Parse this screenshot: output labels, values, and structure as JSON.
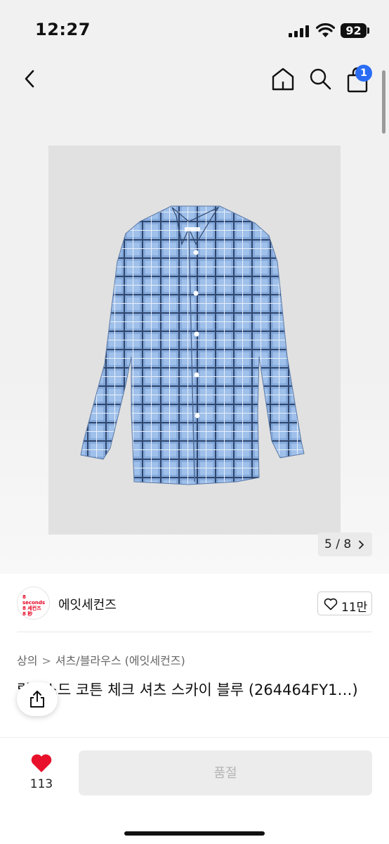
{
  "status_bar": {
    "time": "12:27",
    "battery": "92"
  },
  "nav": {
    "back_icon": "chevron-left-icon",
    "home_icon": "home-icon",
    "search_icon": "search-icon",
    "bag_icon": "shopping-bag-icon",
    "cart_count": "1"
  },
  "gallery": {
    "counter": "5 / 8",
    "image": "blue-check-shirt-photo",
    "colors": {
      "shirt": "#8fb2e2",
      "check_dark": "#2f466d",
      "background": "#e1e1e1"
    }
  },
  "brand": {
    "logo_lines": [
      "8 seconds",
      "8 세컨즈",
      "8 秒"
    ],
    "name": "에잇세컨즈",
    "like_count": "11만"
  },
  "breadcrumb": {
    "items": [
      "상의",
      "셔츠/블라우스 (에잇세컨즈)"
    ],
    "separator": ">"
  },
  "product": {
    "title": "릴렉스드 코튼 체크 셔츠 스카이 블루 (264464FY1…)"
  },
  "bottom_bar": {
    "wish_count": "113",
    "buy_label": "품절",
    "colors": {
      "heart": "#e8102a"
    }
  }
}
